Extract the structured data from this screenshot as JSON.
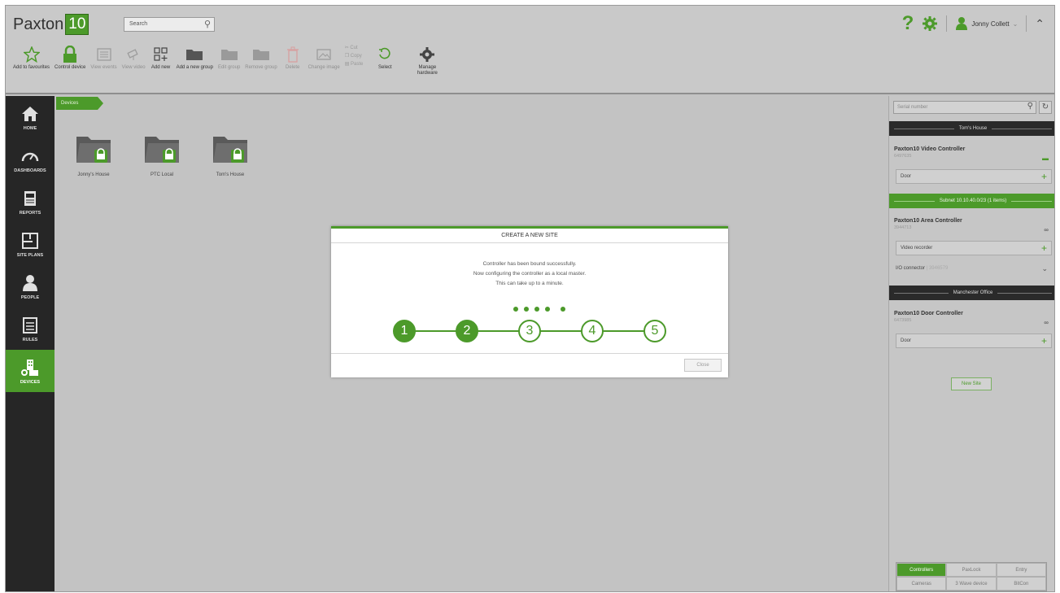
{
  "app": {
    "logo_text": "Paxton",
    "logo_badge": "10"
  },
  "search": {
    "placeholder": "Search"
  },
  "user": {
    "name": "Jonny Collett"
  },
  "toolbar": {
    "add_to_favourites": "Add to favourites",
    "control_device": "Control device",
    "view_events": "View events",
    "view_video": "View video",
    "add_new": "Add new",
    "add_new_group": "Add a new group",
    "edit_group": "Edit group",
    "remove_group": "Remove group",
    "delete": "Delete",
    "change_image": "Change image",
    "cut": "Cut",
    "copy": "Copy",
    "paste": "Paste",
    "select": "Select",
    "manage_hardware_1": "Manage",
    "manage_hardware_2": "hardware"
  },
  "nav": {
    "home": "HOME",
    "dashboards": "DASHBOARDS",
    "reports": "REPORTS",
    "site_plans": "SITE PLANS",
    "people": "PEOPLE",
    "rules": "RULES",
    "devices": "DEVICES"
  },
  "breadcrumb": "Devices",
  "folders": [
    "Jonny's House",
    "PTC Local",
    "Tom's House"
  ],
  "modal": {
    "title": "CREATE A NEW SITE",
    "line1": "Controller has been bound successfully.",
    "line2": "Now configuring the controller as a local master.",
    "line3": "This can take up to a minute.",
    "steps": [
      "1",
      "2",
      "3",
      "4",
      "5"
    ],
    "close": "Close"
  },
  "right_panel": {
    "serial_placeholder": "Serial number",
    "site1": "Tom's House",
    "ctrl1_name": "Paxton10 Video Controller",
    "ctrl1_serial": "6497635",
    "ctrl1_dev": "Door",
    "subnet": "Subnet 10.10.40.0/23 (1 items)",
    "ctrl2_name": "Paxton10 Area Controller",
    "ctrl2_serial": "3944713",
    "ctrl2_dev": "Video recorder",
    "io_label": "I/O connector",
    "io_serial": "3946579",
    "site2": "Manchester Office",
    "ctrl3_name": "Paxton10 Door Controller",
    "ctrl3_serial": "6473985",
    "ctrl3_dev": "Door",
    "new_site": "New Site"
  },
  "tabs": [
    "Controllers",
    "PaxLock",
    "Entry",
    "Cameras",
    "3 Wave device",
    "BitCon"
  ],
  "colors": {
    "accent": "#4c9a2a",
    "nav_bg": "#262626"
  }
}
